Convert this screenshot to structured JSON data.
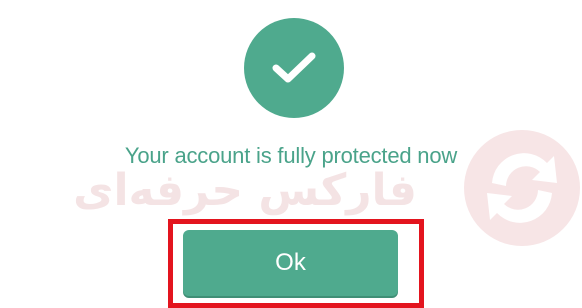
{
  "dialog": {
    "icon": "checkmark-icon",
    "message": "Your account is fully protected now",
    "ok_label": "Ok"
  },
  "watermark": {
    "text": "فارکس حرفه‌ای",
    "logo": "exchange-arrows-icon"
  },
  "colors": {
    "accent": "#4faa8e",
    "message_text": "#4aa38a",
    "highlight_border": "#e3141e",
    "watermark": "#f4e3e4"
  }
}
